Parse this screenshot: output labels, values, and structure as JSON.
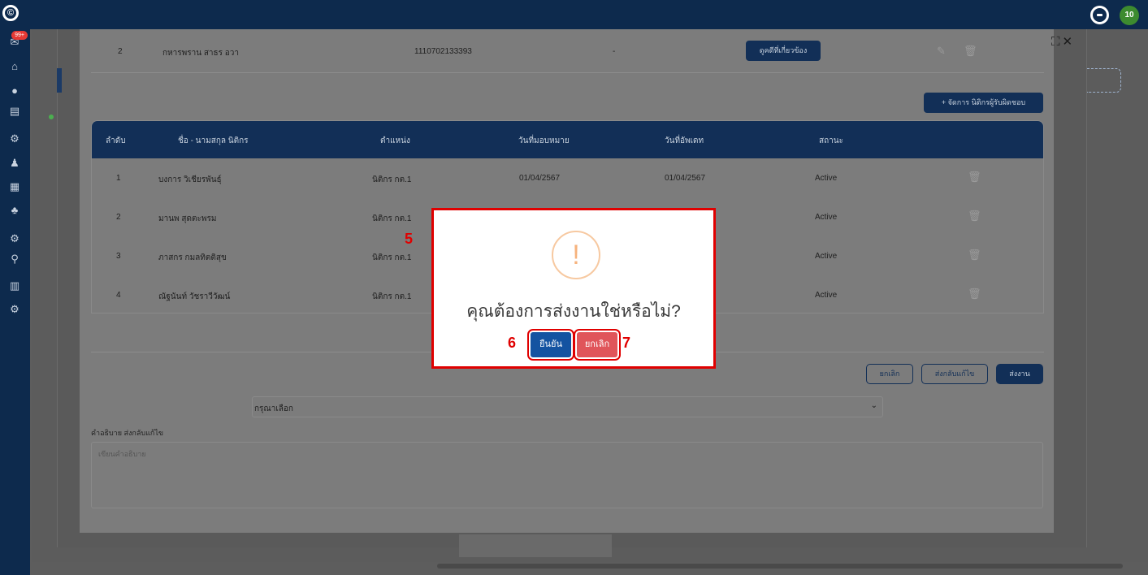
{
  "topbar": {
    "logo_glyph": "©",
    "user_avatar": "10"
  },
  "sidebar": {
    "badge": "99+",
    "icons": [
      "inbox-icon",
      "home-icon",
      "chat-icon",
      "document-icon",
      "gear-icon",
      "person-icon",
      "grid-icon",
      "team-icon",
      "settings-icon",
      "search-icon",
      "chart-icon",
      "config-icon"
    ],
    "expand_glyph": ">"
  },
  "modal": {
    "close_glyph": "✕",
    "expand_glyph": "⛶",
    "prev_row": {
      "no": "2",
      "name": "กหารพราน สาธร อวา",
      "id_number": "1110702133393",
      "dash": "-",
      "related_button": "ดูคดีที่เกี่ยวข้อง"
    },
    "manage_button": "+ จัดการ นิติกรผู้รับผิดชอบ",
    "table": {
      "headers": [
        "ลำดับ",
        "ชื่อ - นามสกุล นิติกร",
        "ตำแหน่ง",
        "วันที่มอบหมาย",
        "วันที่อัพเดท",
        "สถานะ"
      ],
      "rows": [
        {
          "no": "1",
          "name": "บงการ วิเชียรพันธุ์",
          "position": "นิติกร กต.1",
          "assigned": "01/04/2567",
          "updated": "01/04/2567",
          "status": "Active"
        },
        {
          "no": "2",
          "name": "มานพ สุดตะพรม",
          "position": "นิติกร กต.1",
          "assigned": "",
          "updated": "",
          "status": "Active"
        },
        {
          "no": "3",
          "name": "ภาสกร กมลทิตติสุข",
          "position": "นิติกร กต.1",
          "assigned": "",
          "updated": "",
          "status": "Active"
        },
        {
          "no": "4",
          "name": "ณัฐนันท์ วัชราวีวัฒน์",
          "position": "นิติกร กต.1",
          "assigned": "",
          "updated": "",
          "status": "Active"
        }
      ]
    },
    "actions": {
      "cancel": "ยกเลิก",
      "return": "ส่งกลับแก้ไข",
      "send": "ส่งงาน"
    },
    "select": {
      "value": "กรุณาเลือก"
    },
    "description": {
      "label": "คำอธิบาย ส่งกลับแก้ไข",
      "placeholder": "เขียนคำอธิบาย"
    }
  },
  "dialog": {
    "icon_glyph": "!",
    "title": "คุณต้องการส่งงานใช่หรือไม่?",
    "confirm": "ยืนยัน",
    "cancel": "ยกเลิก"
  },
  "steps": {
    "dialog": "5",
    "confirm": "6",
    "cancel": "7"
  },
  "colors": {
    "navy": "#122f57",
    "confirm_blue": "#1453a1",
    "cancel_red": "#e0555a",
    "highlight_red": "#e00000",
    "warning_orange": "#f6b27c"
  }
}
